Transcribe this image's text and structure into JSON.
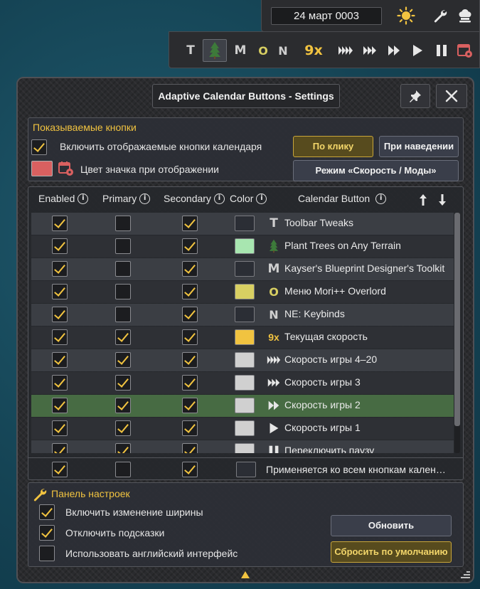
{
  "topbar": {
    "date": "24 март 0003",
    "icons": [
      "sun-icon",
      "wrench-icon",
      "chef-hat-icon"
    ]
  },
  "toolbar": {
    "t_label": "T",
    "m_label": "M",
    "o_label": "O",
    "n_label": "N",
    "speed_label": "9x",
    "icons": [
      "tree-icon",
      "speed-4-icon",
      "speed-3-icon",
      "speed-2-icon",
      "play-icon",
      "pause-icon",
      "calendar-settings-icon"
    ]
  },
  "window": {
    "title": "Adaptive Calendar Buttons - Settings"
  },
  "shown_buttons": {
    "title": "Показываемые кнопки",
    "enable_label": "Включить отображаемые кнопки календаря",
    "enable_checked": true,
    "color_label": "Цвет значка при отображении",
    "icon_color": "#d96060",
    "on_click_label": "По клику",
    "on_hover_label": "При наведении",
    "mode_label": "Режим «Скорость / Моды»"
  },
  "table": {
    "headers": {
      "enabled": "Enabled",
      "primary": "Primary",
      "secondary": "Secondary",
      "color": "Color",
      "calendar_button": "Calendar Button"
    },
    "rows": [
      {
        "enabled": true,
        "primary": false,
        "secondary": true,
        "color": "#2b2e35",
        "icon": "T",
        "name": "Toolbar Tweaks"
      },
      {
        "enabled": true,
        "primary": false,
        "secondary": true,
        "color": "#a8e6b0",
        "icon": "tree",
        "name": "Plant Trees on Any Terrain"
      },
      {
        "enabled": true,
        "primary": false,
        "secondary": true,
        "color": "#2b2e35",
        "icon": "M",
        "name": "Kayser's Blueprint Designer's Toolkit"
      },
      {
        "enabled": true,
        "primary": false,
        "secondary": true,
        "color": "#d8cf62",
        "icon": "O",
        "name": "Меню Mori++ Overlord"
      },
      {
        "enabled": true,
        "primary": false,
        "secondary": true,
        "color": "#2b2e35",
        "icon": "N",
        "name": "NE: Keybinds"
      },
      {
        "enabled": true,
        "primary": true,
        "secondary": true,
        "color": "#f1c340",
        "icon": "9x",
        "name": "Текущая скорость"
      },
      {
        "enabled": true,
        "primary": true,
        "secondary": true,
        "color": "#d0d0d0",
        "icon": "speed4",
        "name": "Скорость игры 4–20"
      },
      {
        "enabled": true,
        "primary": true,
        "secondary": true,
        "color": "#d0d0d0",
        "icon": "speed3",
        "name": "Скорость игры 3"
      },
      {
        "enabled": true,
        "primary": true,
        "secondary": true,
        "color": "#d0d0d0",
        "icon": "speed2",
        "name": "Скорость игры 2"
      },
      {
        "enabled": true,
        "primary": true,
        "secondary": true,
        "color": "#d0d0d0",
        "icon": "play",
        "name": "Скорость игры 1"
      },
      {
        "enabled": true,
        "primary": true,
        "secondary": true,
        "color": "#d0d0d0",
        "icon": "pause",
        "name": "Переключить паузу"
      }
    ],
    "all_row": {
      "enabled": true,
      "primary": false,
      "secondary": true,
      "color": "#2b2e35",
      "name": "Применяется ко всем кнопкам кален…"
    }
  },
  "settings_panel": {
    "title": "Панель настроек",
    "width_label": "Включить изменение ширины",
    "width_checked": true,
    "tooltips_label": "Отключить подсказки",
    "tooltips_checked": true,
    "english_label": "Использовать английский интерфейс",
    "english_checked": false,
    "refresh_label": "Обновить",
    "reset_label": "Сбросить по умолчанию"
  }
}
